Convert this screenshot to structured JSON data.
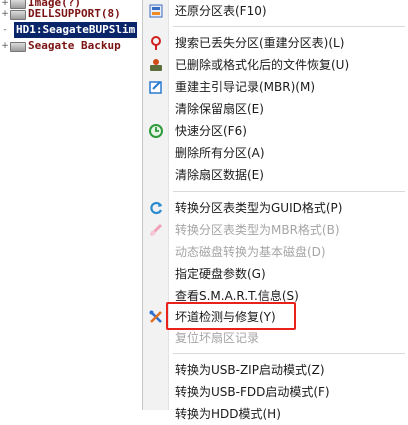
{
  "tree": {
    "items": [
      {
        "text": "Image(?)",
        "expander": "+"
      },
      {
        "text": "DELLSUPPORT(8)",
        "expander": "+"
      },
      {
        "text": "HD1:SeagateBUPSlim",
        "expander": "-"
      },
      {
        "text": "Seagate Backup",
        "expander": "+"
      }
    ]
  },
  "menu": {
    "items": [
      {
        "label": "还原分区表(F10)",
        "icon": "restore-table-icon",
        "disabled": false
      },
      {
        "label": "搜索已丢失分区(重建分区表)(L)",
        "icon": "search-lost-partition-icon",
        "disabled": false
      },
      {
        "label": "已删除或格式化后的文件恢复(U)",
        "icon": "file-recovery-icon",
        "disabled": false
      },
      {
        "label": "重建主引导记录(MBR)(M)",
        "icon": "rebuild-mbr-icon",
        "disabled": false
      },
      {
        "label": "清除保留扇区(E)",
        "icon": "",
        "disabled": false
      },
      {
        "label": "快速分区(F6)",
        "icon": "quick-partition-icon",
        "disabled": false
      },
      {
        "label": "删除所有分区(A)",
        "icon": "",
        "disabled": false
      },
      {
        "label": "清除扇区数据(E)",
        "icon": "",
        "disabled": false
      },
      {
        "label": "转换分区表类型为GUID格式(P)",
        "icon": "convert-guid-icon",
        "disabled": false
      },
      {
        "label": "转换分区表类型为MBR格式(B)",
        "icon": "convert-mbr-icon",
        "disabled": true
      },
      {
        "label": "动态磁盘转换为基本磁盘(D)",
        "icon": "",
        "disabled": true
      },
      {
        "label": "指定硬盘参数(G)",
        "icon": "",
        "disabled": false
      },
      {
        "label": "查看S.M.A.R.T.信息(S)",
        "icon": "",
        "disabled": false
      },
      {
        "label": "坏道检测与修复(Y)",
        "icon": "tools-icon",
        "disabled": false
      },
      {
        "label": "复位坏扇区记录",
        "icon": "",
        "disabled": true
      },
      {
        "label": "转换为USB-ZIP启动模式(Z)",
        "icon": "",
        "disabled": false
      },
      {
        "label": "转换为USB-FDD启动模式(F)",
        "icon": "",
        "disabled": false
      },
      {
        "label": "转换为HDD模式(H)",
        "icon": "",
        "disabled": false
      }
    ]
  },
  "colors": {
    "highlight_box": "#e8211d",
    "selected_tree_bg": "#0a246a",
    "tree_text": "#7a1212",
    "disabled_text": "#a5a5a5"
  }
}
